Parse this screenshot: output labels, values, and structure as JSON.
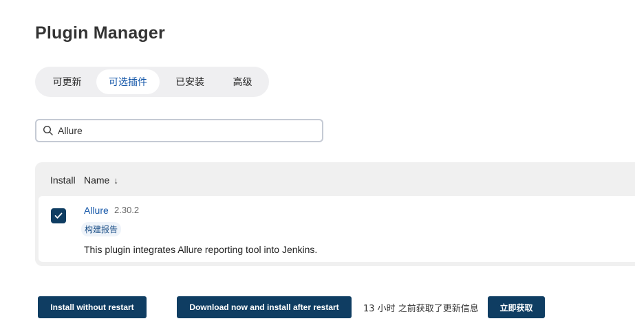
{
  "page": {
    "title": "Plugin Manager"
  },
  "tabs": [
    {
      "label": "可更新"
    },
    {
      "label": "可选插件"
    },
    {
      "label": "已安装"
    },
    {
      "label": "高级"
    }
  ],
  "search": {
    "value": "Allure",
    "icon": "search-icon"
  },
  "table": {
    "columns": {
      "install": "Install",
      "name": "Name",
      "sort": "↓"
    },
    "rows": [
      {
        "checked": true,
        "name": "Allure",
        "version": "2.30.2",
        "tag": "构建报告",
        "description": "This plugin integrates Allure reporting tool into Jenkins."
      }
    ]
  },
  "actions": {
    "install_without_restart": "Install without restart",
    "download_and_install": "Download now and install after restart",
    "status": "13 小时 之前获取了更新信息",
    "fetch_now": "立即获取"
  },
  "colors": {
    "primary": "#0f3d62",
    "link": "#1356a8",
    "tab_bg": "#efeff1",
    "table_bg": "#f0f0f0"
  }
}
